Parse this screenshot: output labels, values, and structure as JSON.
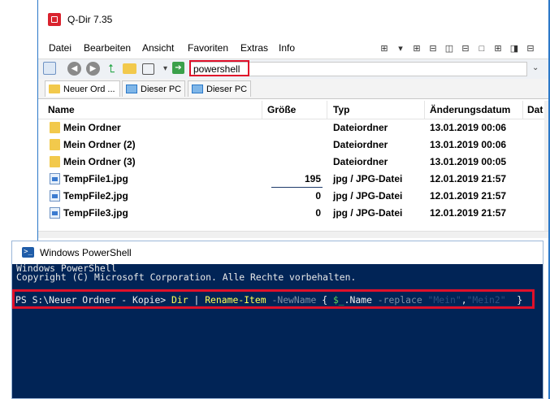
{
  "qdir": {
    "title": "Q-Dir 7.35",
    "menu": [
      "Datei",
      "Bearbeiten",
      "Ansicht",
      "Favoriten",
      "Extras",
      "Info"
    ],
    "address": "powershell",
    "tabs": [
      "Neuer Ord ...",
      "Dieser PC",
      "Dieser PC"
    ],
    "columns": [
      "Name",
      "Größe",
      "Typ",
      "Änderungsdatum",
      "Dat"
    ],
    "files": [
      {
        "name": "Mein Ordner",
        "size": "",
        "type": "Dateiordner",
        "date": "13.01.2019 00:06",
        "icon": "folder-icon"
      },
      {
        "name": "Mein Ordner (2)",
        "size": "",
        "type": "Dateiordner",
        "date": "13.01.2019 00:06",
        "icon": "folder-icon"
      },
      {
        "name": "Mein Ordner (3)",
        "size": "",
        "type": "Dateiordner",
        "date": "13.01.2019 00:05",
        "icon": "folder-icon"
      },
      {
        "name": "TempFile1.jpg",
        "size": "195",
        "type": "jpg / JPG-Datei",
        "date": "12.01.2019 21:57",
        "icon": "image-file-icon"
      },
      {
        "name": "TempFile2.jpg",
        "size": "0",
        "type": "jpg / JPG-Datei",
        "date": "12.01.2019 21:57",
        "icon": "image-file-icon"
      },
      {
        "name": "TempFile3.jpg",
        "size": "0",
        "type": "jpg / JPG-Datei",
        "date": "12.01.2019 21:57",
        "icon": "image-file-icon"
      }
    ]
  },
  "powershell": {
    "title": "Windows PowerShell",
    "header_line1": "Windows PowerShell",
    "header_line2": "Copyright (C) Microsoft Corporation. Alle Rechte vorbehalten.",
    "prompt": "PS S:\\Neuer Ordner - Kopie> ",
    "cmd_dir": "Dir",
    "cmd_pipe": " | ",
    "cmd_rename": "Rename-Item",
    "cmd_param": " -NewName",
    "cmd_brace_open": " { ",
    "cmd_var": "$_",
    "cmd_prop": ".Name",
    "cmd_op": " -replace",
    "cmd_str1": " \"Mein\"",
    "cmd_comma": ",",
    "cmd_str2": "\"Mein2\"",
    "cmd_brace_close": "  }"
  },
  "colors": {
    "ps_background": "#012456",
    "highlight_red": "#e0102a",
    "accent_blue": "#2b78c8"
  }
}
